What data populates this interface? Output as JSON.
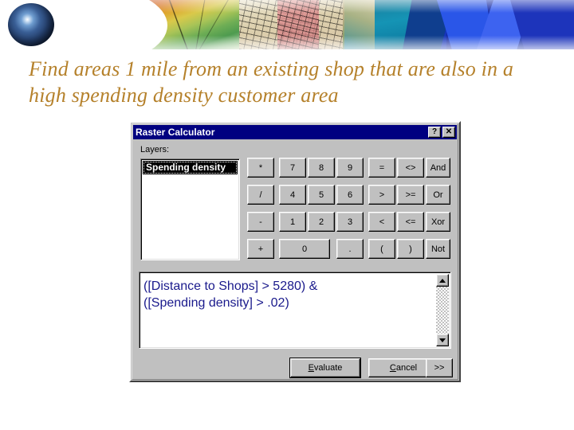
{
  "slide": {
    "title": "Find areas 1 mile from an existing shop that are also in a high spending density customer area",
    "banner_alt": "globe and gis imagery banner"
  },
  "dialog": {
    "title": "Raster Calculator",
    "titlebar_buttons": [
      {
        "name": "help-button",
        "label": "?"
      },
      {
        "name": "close-button",
        "label": "✕"
      }
    ],
    "layers_label": "Layers:",
    "layers": [
      {
        "label": "Spending density",
        "selected": true
      }
    ],
    "keypad": [
      {
        "label": "*",
        "name": "multiply"
      },
      {
        "label": "7",
        "name": "seven"
      },
      {
        "label": "8",
        "name": "eight"
      },
      {
        "label": "9",
        "name": "nine"
      },
      {
        "label": "=",
        "name": "equals"
      },
      {
        "label": "<>",
        "name": "not-equal"
      },
      {
        "label": "And",
        "name": "and"
      },
      {
        "label": "/",
        "name": "divide"
      },
      {
        "label": "4",
        "name": "four"
      },
      {
        "label": "5",
        "name": "five"
      },
      {
        "label": "6",
        "name": "six"
      },
      {
        "label": ">",
        "name": "greater-than"
      },
      {
        "label": ">=",
        "name": "greater-equal"
      },
      {
        "label": "Or",
        "name": "or"
      },
      {
        "label": "-",
        "name": "minus"
      },
      {
        "label": "1",
        "name": "one"
      },
      {
        "label": "2",
        "name": "two"
      },
      {
        "label": "3",
        "name": "three"
      },
      {
        "label": "<",
        "name": "less-than"
      },
      {
        "label": "<=",
        "name": "less-equal"
      },
      {
        "label": "Xor",
        "name": "xor"
      },
      {
        "label": "+",
        "name": "plus"
      },
      {
        "label": "0",
        "name": "zero"
      },
      {
        "label": ".",
        "name": "decimal-point"
      },
      {
        "label": "(",
        "name": "open-paren"
      },
      {
        "label": ")",
        "name": "close-paren"
      },
      {
        "label": "Not",
        "name": "not"
      }
    ],
    "expression": "([Distance to Shops] > 5280) &\n([Spending density] > .02)",
    "scrollbar": {
      "up": "▲",
      "down": "▼"
    },
    "buttons": {
      "evaluate_accel": "E",
      "evaluate_rest": "valuate",
      "cancel_accel": "C",
      "cancel_rest": "ancel",
      "more": ">>"
    }
  },
  "colors": {
    "title_text": "#b5812b",
    "titlebar_bg": "#000080",
    "dialog_face": "#c0c0c0",
    "expression_text": "#1a1a8c",
    "page_bg": "#ffffff"
  }
}
